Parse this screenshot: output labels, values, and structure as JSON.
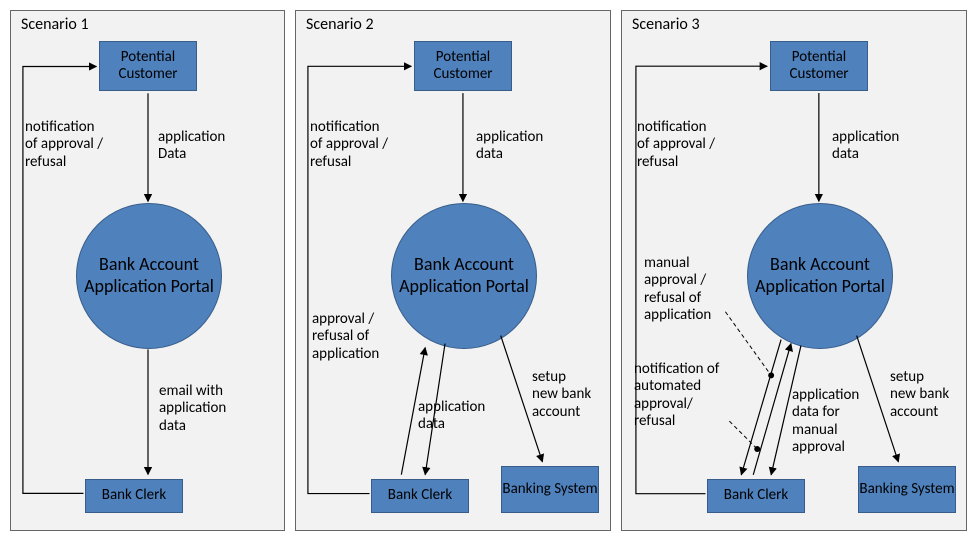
{
  "scenarios": [
    {
      "title": "Scenario 1",
      "nodes": {
        "customer": "Potential\nCustomer",
        "portal": "Bank\nAccount\nApplication\nPortal",
        "clerk": "Bank Clerk"
      },
      "labels": {
        "notification": "notification\nof approval /\nrefusal",
        "appData": "application\nData",
        "email": "email with\napplication\ndata"
      }
    },
    {
      "title": "Scenario 2",
      "nodes": {
        "customer": "Potential\nCustomer",
        "portal": "Bank\nAccount\nApplication\nPortal",
        "clerk": "Bank Clerk",
        "system": "Banking\nSystem"
      },
      "labels": {
        "notification": "notification\nof approval /\nrefusal",
        "appData": "application\ndata",
        "approval": "approval /\nrefusal of\napplication",
        "appData2": "application\ndata",
        "setup": "setup\nnew bank\naccount"
      }
    },
    {
      "title": "Scenario 3",
      "nodes": {
        "customer": "Potential\nCustomer",
        "portal": "Bank\nAccount\nApplication\nPortal",
        "clerk": "Bank Clerk",
        "system": "Banking\nSystem"
      },
      "labels": {
        "notification": "notification\nof approval /\nrefusal",
        "appData": "application\ndata",
        "manual": "manual\napproval /\nrefusal of\napplication",
        "autoNotif": "notification of\nautomated\napproval/\nrefusal",
        "appManual": "application\ndata for\nmanual\napproval",
        "setup": "setup\nnew bank\naccount"
      }
    }
  ]
}
